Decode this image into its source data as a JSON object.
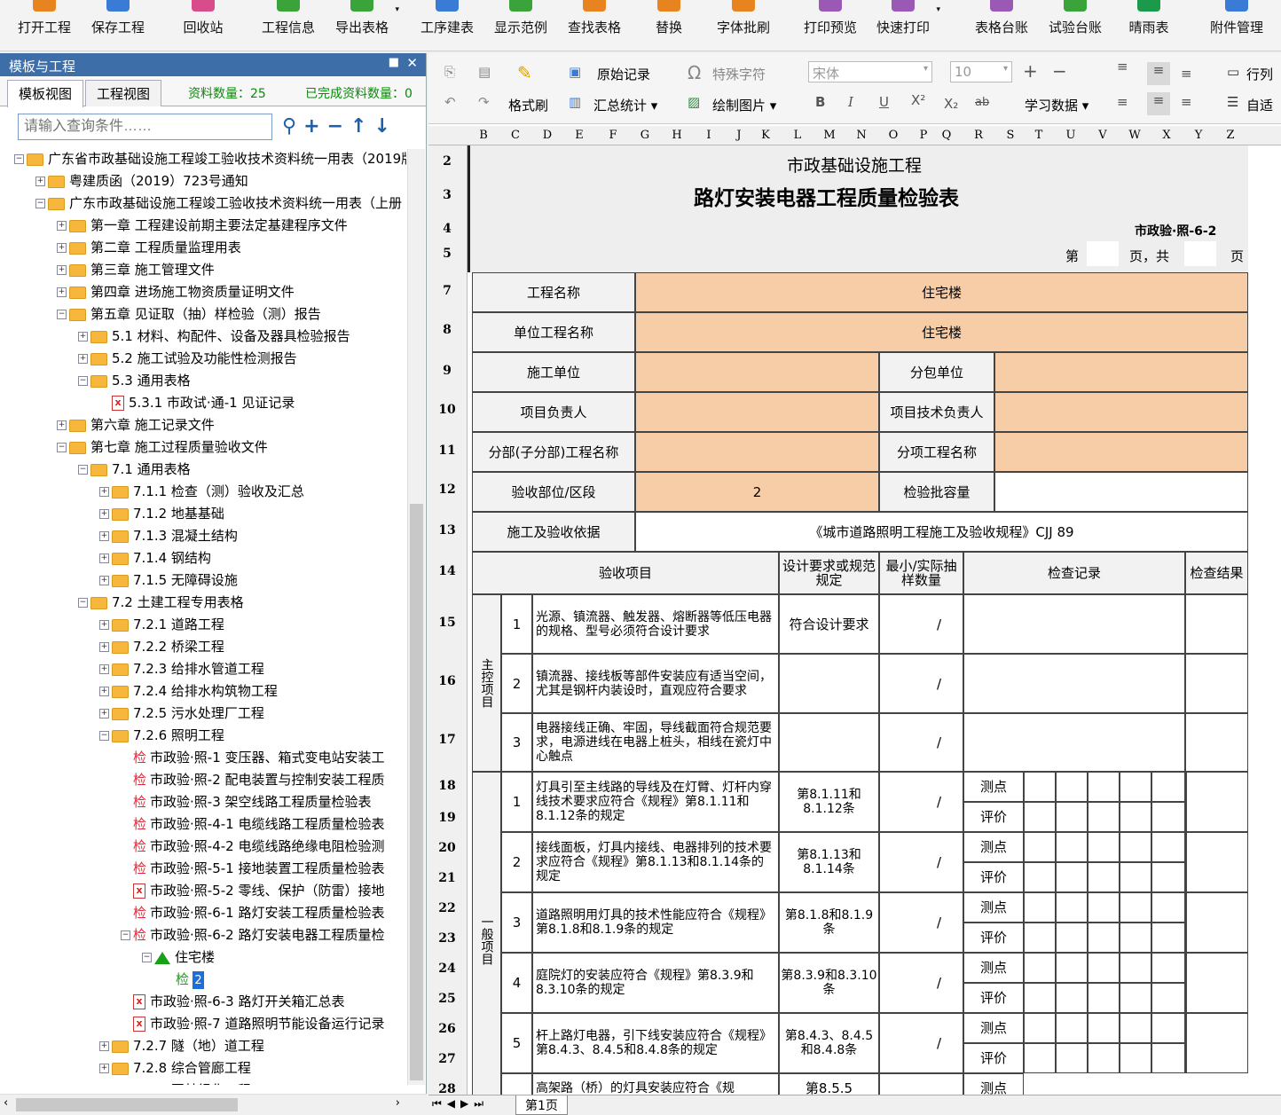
{
  "toolbar": [
    {
      "label": "打开工程",
      "icon": "open-project-icon",
      "color": "#e8841f"
    },
    {
      "label": "保存工程",
      "icon": "save-project-icon",
      "color": "#3a7bd5"
    },
    {
      "label": "回收站",
      "icon": "recycle-bin-icon",
      "color": "#d94c8c"
    },
    {
      "label": "工程信息",
      "icon": "project-info-icon",
      "color": "#3aa33a"
    },
    {
      "label": "导出表格",
      "icon": "export-table-icon",
      "color": "#3aa33a"
    },
    {
      "label": "工序建表",
      "icon": "process-table-icon",
      "color": "#3a7bd5"
    },
    {
      "label": "显示范例",
      "icon": "show-example-icon",
      "color": "#3aa33a"
    },
    {
      "label": "查找表格",
      "icon": "find-table-icon",
      "color": "#e8841f"
    },
    {
      "label": "替换",
      "icon": "replace-icon",
      "color": "#e8841f"
    },
    {
      "label": "字体批刷",
      "icon": "font-brush-icon",
      "color": "#e8841f"
    },
    {
      "label": "打印预览",
      "icon": "print-preview-icon",
      "color": "#9b59b6"
    },
    {
      "label": "快速打印",
      "icon": "quick-print-icon",
      "color": "#9b59b6"
    },
    {
      "label": "表格台账",
      "icon": "table-ledger-icon",
      "color": "#9b59b6"
    },
    {
      "label": "试验台账",
      "icon": "test-ledger-icon",
      "color": "#3aa33a"
    },
    {
      "label": "晴雨表",
      "icon": "weather-icon",
      "color": "#1a9a4a"
    },
    {
      "label": "附件管理",
      "icon": "attachment-icon",
      "color": "#3a7bd5"
    }
  ],
  "left_panel": {
    "title": "模板与工程",
    "tab_template": "模板视图",
    "tab_project": "工程视图",
    "doc_count": "资料数量：25",
    "done_count": "已完成资料数量：0",
    "search_placeholder": "请输入查询条件……",
    "tree": [
      {
        "level": 0,
        "type": "folder",
        "exp": "−",
        "text": "广东省市政基础设施工程竣工验收技术资料统一用表（2019版"
      },
      {
        "level": 1,
        "type": "folder",
        "exp": "+",
        "text": "粤建质函（2019）723号通知"
      },
      {
        "level": 1,
        "type": "folder",
        "exp": "−",
        "text": "广东市政基础设施工程竣工验收技术资料统一用表（上册"
      },
      {
        "level": 2,
        "type": "folder",
        "exp": "+",
        "text": "第一章 工程建设前期主要法定基建程序文件"
      },
      {
        "level": 2,
        "type": "folder",
        "exp": "+",
        "text": "第二章 工程质量监理用表"
      },
      {
        "level": 2,
        "type": "folder",
        "exp": "+",
        "text": "第三章 施工管理文件"
      },
      {
        "level": 2,
        "type": "folder",
        "exp": "+",
        "text": "第四章 进场施工物资质量证明文件"
      },
      {
        "level": 2,
        "type": "folder",
        "exp": "−",
        "text": "第五章 见证取（抽）样检验（测）报告"
      },
      {
        "level": 3,
        "type": "folder",
        "exp": "+",
        "text": "5.1 材料、构配件、设备及器具检验报告"
      },
      {
        "level": 3,
        "type": "folder",
        "exp": "+",
        "text": "5.2 施工试验及功能性检测报告"
      },
      {
        "level": 3,
        "type": "folder",
        "exp": "−",
        "text": "5.3 通用表格"
      },
      {
        "level": 4,
        "type": "doc",
        "exp": "",
        "text": "5.3.1 市政试·通-1 见证记录"
      },
      {
        "level": 2,
        "type": "folder",
        "exp": "+",
        "text": "第六章 施工记录文件"
      },
      {
        "level": 2,
        "type": "folder",
        "exp": "−",
        "text": "第七章 施工过程质量验收文件"
      },
      {
        "level": 3,
        "type": "folder",
        "exp": "−",
        "text": "7.1 通用表格"
      },
      {
        "level": 4,
        "type": "folder",
        "exp": "+",
        "text": "7.1.1 检查（测）验收及汇总"
      },
      {
        "level": 4,
        "type": "folder",
        "exp": "+",
        "text": "7.1.2 地基基础"
      },
      {
        "level": 4,
        "type": "folder",
        "exp": "+",
        "text": "7.1.3 混凝土结构"
      },
      {
        "level": 4,
        "type": "folder",
        "exp": "+",
        "text": "7.1.4 钢结构"
      },
      {
        "level": 4,
        "type": "folder",
        "exp": "+",
        "text": "7.1.5 无障碍设施"
      },
      {
        "level": 3,
        "type": "folder",
        "exp": "−",
        "text": "7.2 土建工程专用表格"
      },
      {
        "level": 4,
        "type": "folder",
        "exp": "+",
        "text": "7.2.1 道路工程"
      },
      {
        "level": 4,
        "type": "folder",
        "exp": "+",
        "text": "7.2.2 桥梁工程"
      },
      {
        "level": 4,
        "type": "folder",
        "exp": "+",
        "text": "7.2.3 给排水管道工程"
      },
      {
        "level": 4,
        "type": "folder",
        "exp": "+",
        "text": "7.2.4 给排水构筑物工程"
      },
      {
        "level": 4,
        "type": "folder",
        "exp": "+",
        "text": "7.2.5 污水处理厂工程"
      },
      {
        "level": 4,
        "type": "folder",
        "exp": "−",
        "text": "7.2.6 照明工程"
      },
      {
        "level": 5,
        "type": "check",
        "exp": "",
        "text": "市政验·照-1 变压器、箱式变电站安装工"
      },
      {
        "level": 5,
        "type": "check",
        "exp": "",
        "text": "市政验·照-2 配电装置与控制安装工程质"
      },
      {
        "level": 5,
        "type": "check",
        "exp": "",
        "text": "市政验·照-3 架空线路工程质量检验表"
      },
      {
        "level": 5,
        "type": "check",
        "exp": "",
        "text": "市政验·照-4-1 电缆线路工程质量检验表"
      },
      {
        "level": 5,
        "type": "check",
        "exp": "",
        "text": "市政验·照-4-2 电缆线路绝缘电阻检验测"
      },
      {
        "level": 5,
        "type": "check",
        "exp": "",
        "text": "市政验·照-5-1 接地装置工程质量检验表"
      },
      {
        "level": 5,
        "type": "doc",
        "exp": "",
        "text": "市政验·照-5-2 零线、保护（防雷）接地"
      },
      {
        "level": 5,
        "type": "check",
        "exp": "",
        "text": "市政验·照-6-1 路灯安装工程质量检验表"
      },
      {
        "level": 5,
        "type": "check",
        "exp": "−",
        "text": "市政验·照-6-2 路灯安装电器工程质量检"
      },
      {
        "level": 6,
        "type": "home",
        "exp": "−",
        "text": "住宅楼"
      },
      {
        "level": 7,
        "type": "selected",
        "exp": "",
        "text": "2"
      },
      {
        "level": 5,
        "type": "doc",
        "exp": "",
        "text": "市政验·照-6-3 路灯开关箱汇总表"
      },
      {
        "level": 5,
        "type": "doc",
        "exp": "",
        "text": "市政验·照-7 道路照明节能设备运行记录"
      },
      {
        "level": 4,
        "type": "folder",
        "exp": "+",
        "text": "7.2.7 隧（地）道工程"
      },
      {
        "level": 4,
        "type": "folder",
        "exp": "+",
        "text": "7.2.8 综合管廊工程"
      },
      {
        "level": 4,
        "type": "folder",
        "exp": "+",
        "text": "7.2.9 园林绿化工程"
      }
    ]
  },
  "ribbon": {
    "copy": "复制",
    "paste": "粘贴",
    "undo": "撤销",
    "redo": "重做",
    "format_brush": "格式刷",
    "original_record": "原始记录",
    "summary_stats": "汇总统计",
    "special_char": "特殊字符",
    "draw_image": "绘制图片",
    "font_name": "宋体",
    "font_size": "10",
    "study_data": "学习数据",
    "row_col": "行列",
    "auto": "自适"
  },
  "columns": [
    "B",
    "C",
    "D",
    "E",
    "F",
    "G",
    "H",
    "I",
    "J",
    "K",
    "L",
    "M",
    "N",
    "O",
    "P",
    "Q",
    "R",
    "S",
    "T",
    "U",
    "V",
    "W",
    "X",
    "Y",
    "Z"
  ],
  "rows": [
    "2",
    "3",
    "4",
    "5",
    "7",
    "8",
    "9",
    "10",
    "11",
    "12",
    "13",
    "14",
    "15",
    "16",
    "17",
    "18",
    "19",
    "20",
    "21",
    "22",
    "23",
    "24",
    "25",
    "26",
    "27",
    "28"
  ],
  "form": {
    "subtitle": "市政基础设施工程",
    "title": "路灯安装电器工程质量检验表",
    "code": "市政验·照-6-2",
    "page_label_1": "第",
    "page_label_2": "页，共",
    "page_label_3": "页",
    "project_name_label": "工程名称",
    "project_name": "住宅楼",
    "unit_name_label": "单位工程名称",
    "unit_name": "住宅楼",
    "constructor_label": "施工单位",
    "subcontractor_label": "分包单位",
    "pm_label": "项目负责人",
    "tech_label": "项目技术负责人",
    "subdiv_label": "分部(子分部)工程名称",
    "item_label": "分项工程名称",
    "part_label": "验收部位/区段",
    "part_value": "2",
    "batch_label": "检验批容量",
    "basis_label": "施工及验收依据",
    "basis_value": "《城市道路照明工程施工及验收规程》CJJ 89",
    "h_item": "验收项目",
    "h_design": "设计要求或规范规定",
    "h_sample": "最小/实际抽样数量",
    "h_record": "检查记录",
    "h_result": "检查结果",
    "main_label": "主控项目",
    "general_label": "一般项目",
    "main_items": [
      {
        "no": "1",
        "text": "光源、镇流器、触发器、熔断器等低压电器的规格、型号必须符合设计要求",
        "design": "符合设计要求",
        "sample": "/"
      },
      {
        "no": "2",
        "text": "镇流器、接线板等部件安装应有适当空间，尤其是钢杆内装设时，直观应符合要求",
        "design": "",
        "sample": "/"
      },
      {
        "no": "3",
        "text": "电器接线正确、牢固，导线截面符合规范要求，电源进线在电器上桩头，相线在瓷灯中心触点",
        "design": "",
        "sample": "/"
      }
    ],
    "general_items": [
      {
        "no": "1",
        "text": "灯具引至主线路的导线及在灯臂、灯杆内穿线技术要求应符合《规程》第8.1.11和8.1.12条的规定",
        "design": "第8.1.11和8.1.12条",
        "sample": "/"
      },
      {
        "no": "2",
        "text": "接线面板，灯具内接线、电器排列的技术要求应符合《规程》第8.1.13和8.1.14条的规定",
        "design": "第8.1.13和8.1.14条",
        "sample": "/"
      },
      {
        "no": "3",
        "text": "道路照明用灯具的技术性能应符合《规程》第8.1.8和8.1.9条的规定",
        "design": "第8.1.8和8.1.9条",
        "sample": "/"
      },
      {
        "no": "4",
        "text": "庭院灯的安装应符合《规程》第8.3.9和8.3.10条的规定",
        "design": "第8.3.9和8.3.10条",
        "sample": "/"
      },
      {
        "no": "5",
        "text": "杆上路灯电器，引下线安装应符合《规程》第8.4.3、8.4.5和8.4.8条的规定",
        "design": "第8.4.3、8.4.5和8.4.8条",
        "sample": "/"
      }
    ],
    "row6_text": "高架路（桥）的灯具安装应符合《规",
    "row6_design": "第8.5.5",
    "measure": "测点",
    "evaluate": "评价"
  },
  "sheet_tab": "第1页"
}
